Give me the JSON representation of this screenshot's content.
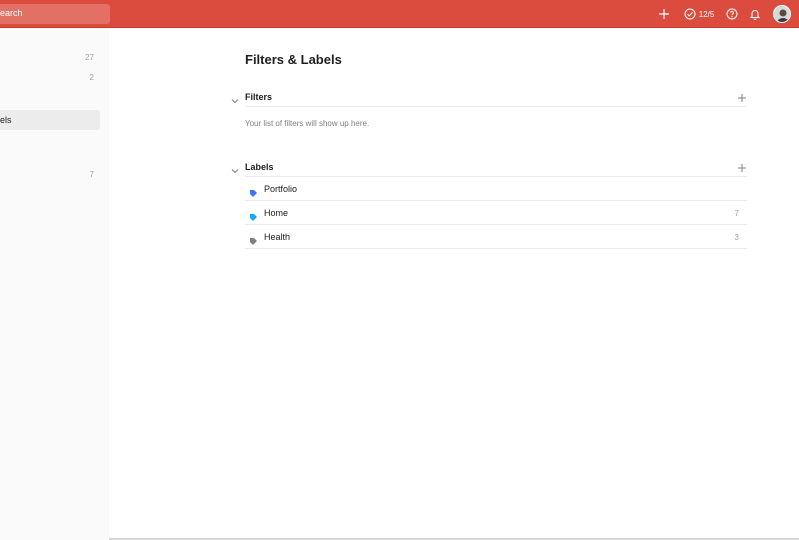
{
  "topbar": {
    "search_placeholder": "earch",
    "karma_value": "12/5",
    "brand_color": "#db4c3f",
    "icons": [
      "plus-icon",
      "karma-check-icon",
      "help-icon",
      "bell-icon",
      "avatar"
    ]
  },
  "sidebar": {
    "items": [
      {
        "label": "",
        "count": "27"
      },
      {
        "label": "",
        "count": "2"
      },
      {
        "label": "els",
        "count": "",
        "active": true
      },
      {
        "label": "",
        "count": "7"
      }
    ]
  },
  "main": {
    "title": "Filters & Labels",
    "filters": {
      "title": "Filters",
      "empty_message": "Your list of filters will show up here."
    },
    "labels": {
      "title": "Labels",
      "items": [
        {
          "name": "Portfolio",
          "count": "",
          "color": "#4073ff"
        },
        {
          "name": "Home",
          "count": "7",
          "color": "#14aaf5"
        },
        {
          "name": "Health",
          "count": "3",
          "color": "#808080"
        }
      ]
    }
  }
}
